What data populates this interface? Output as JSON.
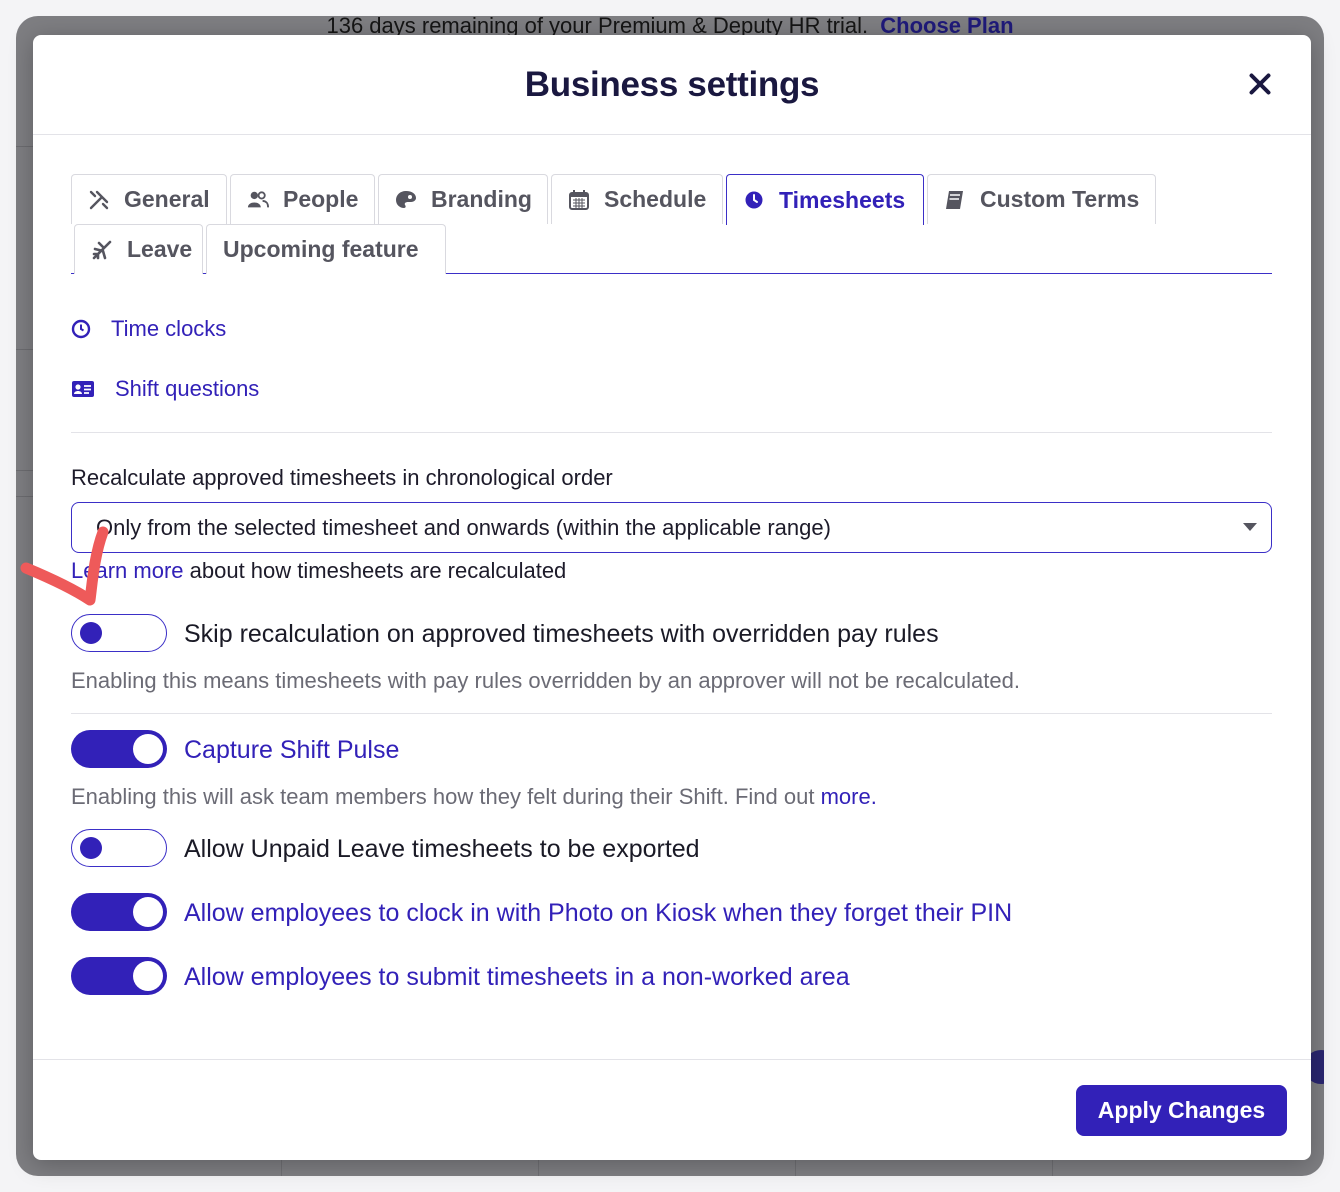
{
  "background": {
    "trial_text": "136 days remaining of your Premium & Deputy HR trial.",
    "choose_plan": "Choose Plan"
  },
  "modal": {
    "title": "Business settings",
    "close_icon": "close-icon"
  },
  "tabs": [
    {
      "label": "General",
      "icon": "tools-icon",
      "active": false
    },
    {
      "label": "People",
      "icon": "people-icon",
      "active": false
    },
    {
      "label": "Branding",
      "icon": "palette-icon",
      "active": false
    },
    {
      "label": "Schedule",
      "icon": "calendar-icon",
      "active": false
    },
    {
      "label": "Timesheets",
      "icon": "clock-icon",
      "active": true
    },
    {
      "label": "Custom Terms",
      "icon": "book-icon",
      "active": false
    },
    {
      "label": "Leave",
      "icon": "plane-icon",
      "active": false
    },
    {
      "label": "Upcoming feature",
      "icon": "",
      "active": false
    }
  ],
  "subnav": {
    "time_clocks": "Time clocks",
    "shift_questions": "Shift questions"
  },
  "recalc": {
    "label": "Recalculate approved timesheets in chronological order",
    "selected": "Only from the selected timesheet and onwards (within the applicable range)",
    "learn_link": "Learn more",
    "learn_rest": " about how timesheets are recalculated"
  },
  "settings": {
    "skip_recalc": {
      "label": "Skip recalculation on approved timesheets with overridden pay rules",
      "enabled": false,
      "desc": "Enabling this means timesheets with pay rules overridden by an approver will not be recalculated."
    },
    "shift_pulse": {
      "label": "Capture Shift Pulse",
      "enabled": true,
      "desc": "Enabling this will ask team members how they felt during their Shift. Find out ",
      "desc_link": "more."
    },
    "unpaid_leave": {
      "label": "Allow Unpaid Leave timesheets to be exported",
      "enabled": false
    },
    "photo_kiosk": {
      "label": "Allow employees to clock in with Photo on Kiosk when they forget their PIN",
      "enabled": true
    },
    "non_worked_area": {
      "label": "Allow employees to submit timesheets in a non-worked area",
      "enabled": true
    }
  },
  "footer": {
    "apply_label": "Apply Changes"
  },
  "colors": {
    "accent": "#3221b8",
    "annotation": "#ee5a5a"
  }
}
